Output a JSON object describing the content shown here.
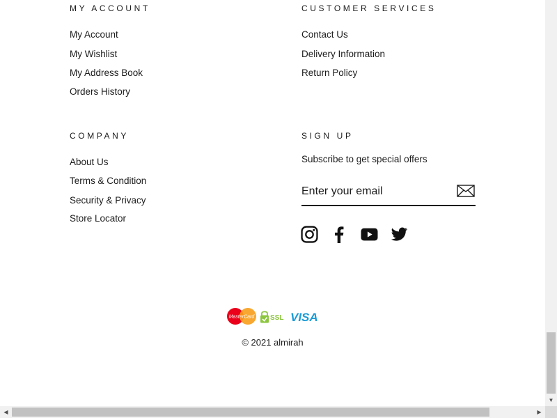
{
  "my_account": {
    "heading": "MY ACCOUNT",
    "links": [
      "My Account",
      "My Wishlist",
      "My Address Book",
      "Orders History"
    ]
  },
  "customer_services": {
    "heading": "CUSTOMER SERVICES",
    "links": [
      "Contact Us",
      "Delivery Information",
      "Return Policy"
    ]
  },
  "company": {
    "heading": "COMPANY",
    "links": [
      "About Us",
      "Terms & Condition",
      "Security & Privacy",
      "Store Locator"
    ]
  },
  "signup": {
    "heading": "SIGN UP",
    "subtext": "Subscribe to get special offers",
    "email_placeholder": "Enter your email",
    "submit_icon": "envelope-icon"
  },
  "social": [
    "instagram-icon",
    "facebook-icon",
    "youtube-icon",
    "twitter-icon"
  ],
  "payments": {
    "mastercard_text": "MasterCard",
    "ssl_text": "SSL",
    "visa_text": "VISA"
  },
  "copyright": "© 2021 almirah",
  "colors": {
    "text": "#1c1c1c",
    "mastercard_red": "#eb001b",
    "mastercard_orange": "#f79e1b",
    "ssl_green": "#8cc63f",
    "visa_blue": "#1a9bd7",
    "scrollbar_track": "#f1f1f1",
    "scrollbar_thumb": "#c1c1c1"
  }
}
